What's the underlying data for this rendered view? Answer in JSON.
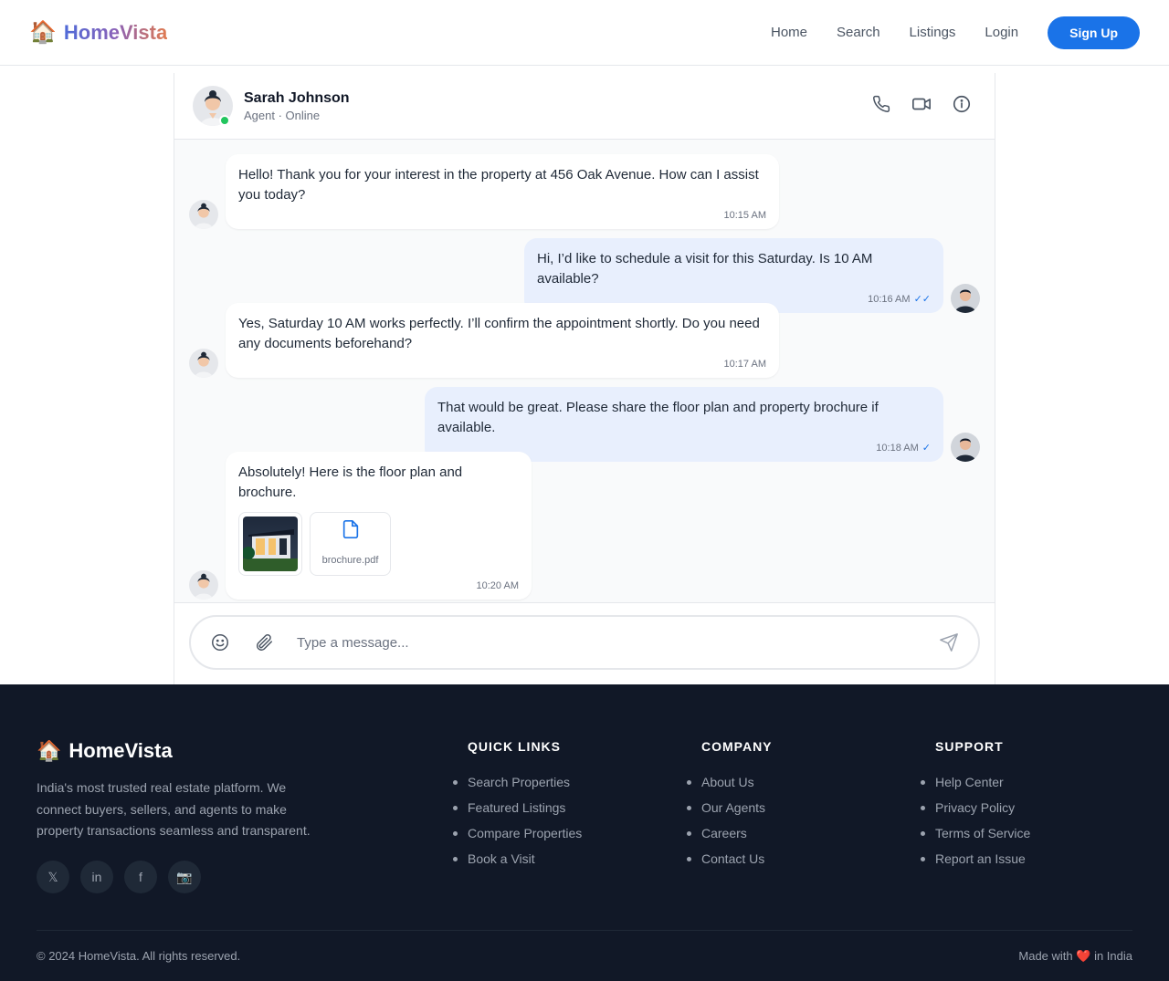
{
  "nav": {
    "brand": "HomeVista",
    "links": [
      "Home",
      "Search",
      "Listings",
      "Login"
    ],
    "signup": "Sign Up"
  },
  "chat": {
    "contact_name": "Sarah Johnson",
    "contact_status": "Agent · Online",
    "messages": [
      {
        "from": "agent",
        "text": "Hello! Thank you for your interest in the property at 456 Oak Avenue. How can I assist you today?",
        "time": "10:15 AM"
      },
      {
        "from": "user",
        "text": "Hi, I’d like to schedule a visit for this Saturday. Is 10 AM available?",
        "time": "10:16 AM",
        "ticks": "✓✓"
      },
      {
        "from": "agent",
        "text": "Yes, Saturday 10 AM works perfectly. I’ll confirm the appointment shortly. Do you need any documents beforehand?",
        "time": "10:17 AM"
      },
      {
        "from": "user",
        "text": "That would be great. Please share the floor plan and property brochure if available.",
        "time": "10:18 AM",
        "ticks": "✓"
      },
      {
        "from": "agent",
        "text": "Absolutely! Here is the floor plan and brochure.",
        "time": "10:20 AM",
        "attachment_file": "brochure.pdf"
      }
    ],
    "input_placeholder": "Type a message..."
  },
  "footer": {
    "brand": "HomeVista",
    "description": "India's most trusted real estate platform. We connect buyers, sellers, and agents to make property transactions seamless and transparent.",
    "socials": [
      "𝕏",
      "in",
      "f",
      "📷"
    ],
    "columns": [
      {
        "title": "QUICK LINKS",
        "items": [
          "Search Properties",
          "Featured Listings",
          "Compare Properties",
          "Book a Visit"
        ]
      },
      {
        "title": "COMPANY",
        "items": [
          "About Us",
          "Our Agents",
          "Careers",
          "Contact Us"
        ]
      },
      {
        "title": "SUPPORT",
        "items": [
          "Help Center",
          "Privacy Policy",
          "Terms of Service",
          "Report an Issue"
        ]
      }
    ],
    "copyright": "© 2024 HomeVista. All rights reserved.",
    "made_prefix": "Made with",
    "made_heart": "❤️",
    "made_suffix": "in India"
  },
  "colors": {
    "accent": "#1a73e8",
    "footer_bg": "#111827",
    "online": "#22c55e",
    "user_bubble": "#e8effd"
  }
}
